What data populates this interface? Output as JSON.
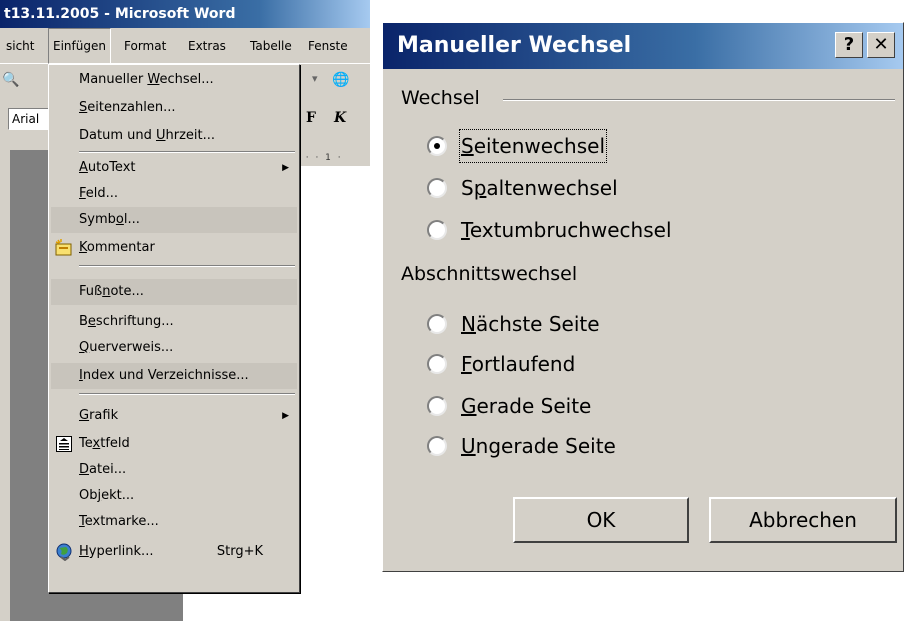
{
  "word": {
    "title": "t13.11.2005 - Microsoft Word",
    "menubar": [
      "sicht",
      "Einfügen",
      "Format",
      "Extras",
      "Tabelle",
      "Fenste"
    ],
    "font_name": "Arial",
    "toolbar_bold": "F",
    "toolbar_italic": "K",
    "ruler_text": "· · · 1 ·"
  },
  "einfuegen_menu": {
    "items": [
      {
        "pre": "Manueller ",
        "ul": "W",
        "post": "echsel..."
      },
      {
        "pre": "",
        "ul": "S",
        "post": "eitenzahlen..."
      },
      {
        "pre": "Datum und ",
        "ul": "U",
        "post": "hrzeit..."
      },
      {
        "pre": "",
        "ul": "A",
        "post": "utoText"
      },
      {
        "pre": "",
        "ul": "F",
        "post": "eld..."
      },
      {
        "pre": "Symb",
        "ul": "o",
        "post": "l..."
      },
      {
        "pre": "",
        "ul": "K",
        "post": "ommentar"
      },
      {
        "pre": "Fuß",
        "ul": "n",
        "post": "ote..."
      },
      {
        "pre": "B",
        "ul": "e",
        "post": "schriftung..."
      },
      {
        "pre": "",
        "ul": "Q",
        "post": "uerverweis..."
      },
      {
        "pre": "",
        "ul": "I",
        "post": "ndex und Verzeichnisse..."
      },
      {
        "pre": "",
        "ul": "G",
        "post": "rafik"
      },
      {
        "pre": "Te",
        "ul": "x",
        "post": "tfeld"
      },
      {
        "pre": "",
        "ul": "D",
        "post": "atei..."
      },
      {
        "pre": "Ob",
        "ul": "j",
        "post": "ekt..."
      },
      {
        "pre": "",
        "ul": "T",
        "post": "extmarke..."
      },
      {
        "pre": "",
        "ul": "H",
        "post": "yperlink..."
      }
    ],
    "hyperlink_shortcut": "Strg+K"
  },
  "dialog": {
    "title": "Manueller Wechsel",
    "help_btn": "?",
    "close_btn": "✕",
    "group1": "Wechsel",
    "group2": "Abschnittswechsel",
    "options1": [
      {
        "ul": "S",
        "post": "eitenwechsel",
        "checked": true
      },
      {
        "pre": "S",
        "ul": "p",
        "post": "altenwechsel",
        "checked": false
      },
      {
        "ul": "T",
        "post": "extumbruchwechsel",
        "checked": false
      }
    ],
    "options2": [
      {
        "ul": "N",
        "post": "ächste Seite",
        "checked": false
      },
      {
        "ul": "F",
        "post": "ortlaufend",
        "checked": false
      },
      {
        "ul": "G",
        "post": "erade Seite",
        "checked": false
      },
      {
        "ul": "U",
        "post": "ngerade Seite",
        "checked": false
      }
    ],
    "ok": "OK",
    "cancel": "Abbrechen"
  }
}
